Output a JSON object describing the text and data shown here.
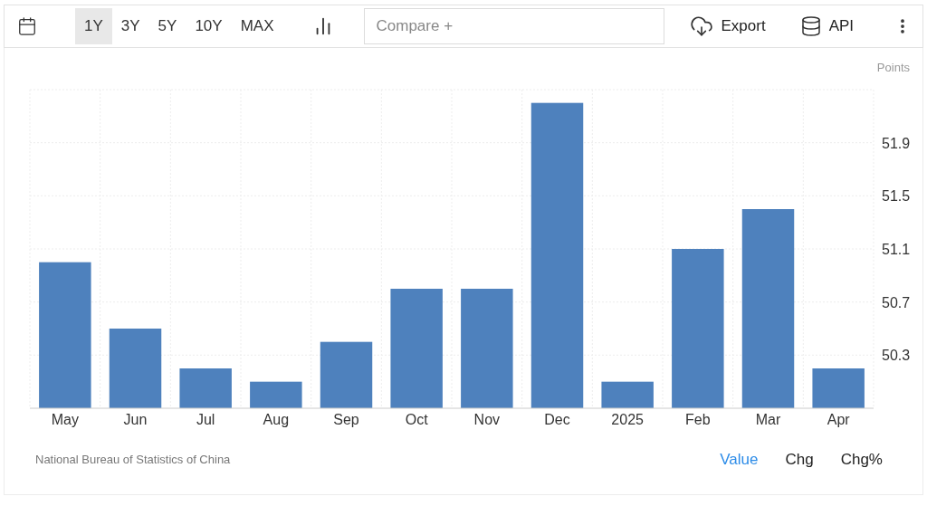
{
  "toolbar": {
    "ranges": [
      {
        "label": "1Y",
        "selected": true
      },
      {
        "label": "3Y",
        "selected": false
      },
      {
        "label": "5Y",
        "selected": false
      },
      {
        "label": "10Y",
        "selected": false
      },
      {
        "label": "MAX",
        "selected": false
      }
    ],
    "compare": {
      "placeholder": "Compare +"
    },
    "export": "Export",
    "api": "API"
  },
  "chart": {
    "chart_data": {
      "type": "bar",
      "ylabel": "Points",
      "categories": [
        "May",
        "Jun",
        "Jul",
        "Aug",
        "Sep",
        "Oct",
        "Nov",
        "Dec",
        "2025",
        "Feb",
        "Mar",
        "Apr"
      ],
      "grid": true,
      "series": [
        {
          "color": "#4e81bd",
          "values": [
            51.0,
            50.5,
            50.2,
            50.1,
            50.4,
            50.8,
            50.8,
            52.2,
            50.1,
            51.1,
            51.4,
            50.2
          ]
        }
      ],
      "ylim": [
        49.9,
        52.3
      ],
      "yticks": [
        {
          "value": 50.3,
          "label": "50.3"
        },
        {
          "value": 50.7,
          "label": "50.7"
        },
        {
          "value": 51.1,
          "label": "51.1"
        },
        {
          "value": 51.5,
          "label": "51.5"
        },
        {
          "value": 51.9,
          "label": "51.9"
        }
      ]
    }
  },
  "footer": {
    "source": "National Bureau of Statistics of China",
    "modes": [
      {
        "label": "Value",
        "selected": true
      },
      {
        "label": "Chg",
        "selected": false
      },
      {
        "label": "Chg%",
        "selected": false
      }
    ]
  }
}
